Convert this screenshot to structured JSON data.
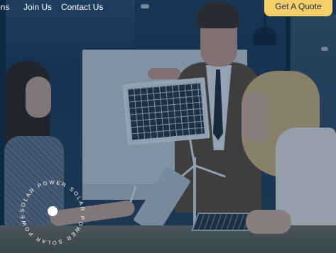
{
  "nav": {
    "links": [
      {
        "label": "ons"
      },
      {
        "label": "Join Us"
      },
      {
        "label": "Contact Us"
      }
    ],
    "cta_label": "Get A Quote"
  },
  "badge": {
    "text": "SOLAR POWER SOLAR POWER SOLAR POWER"
  },
  "colors": {
    "accent": "#f5cf6a",
    "overlay": "#0e2c4e",
    "nav_text": "#ffffff"
  }
}
